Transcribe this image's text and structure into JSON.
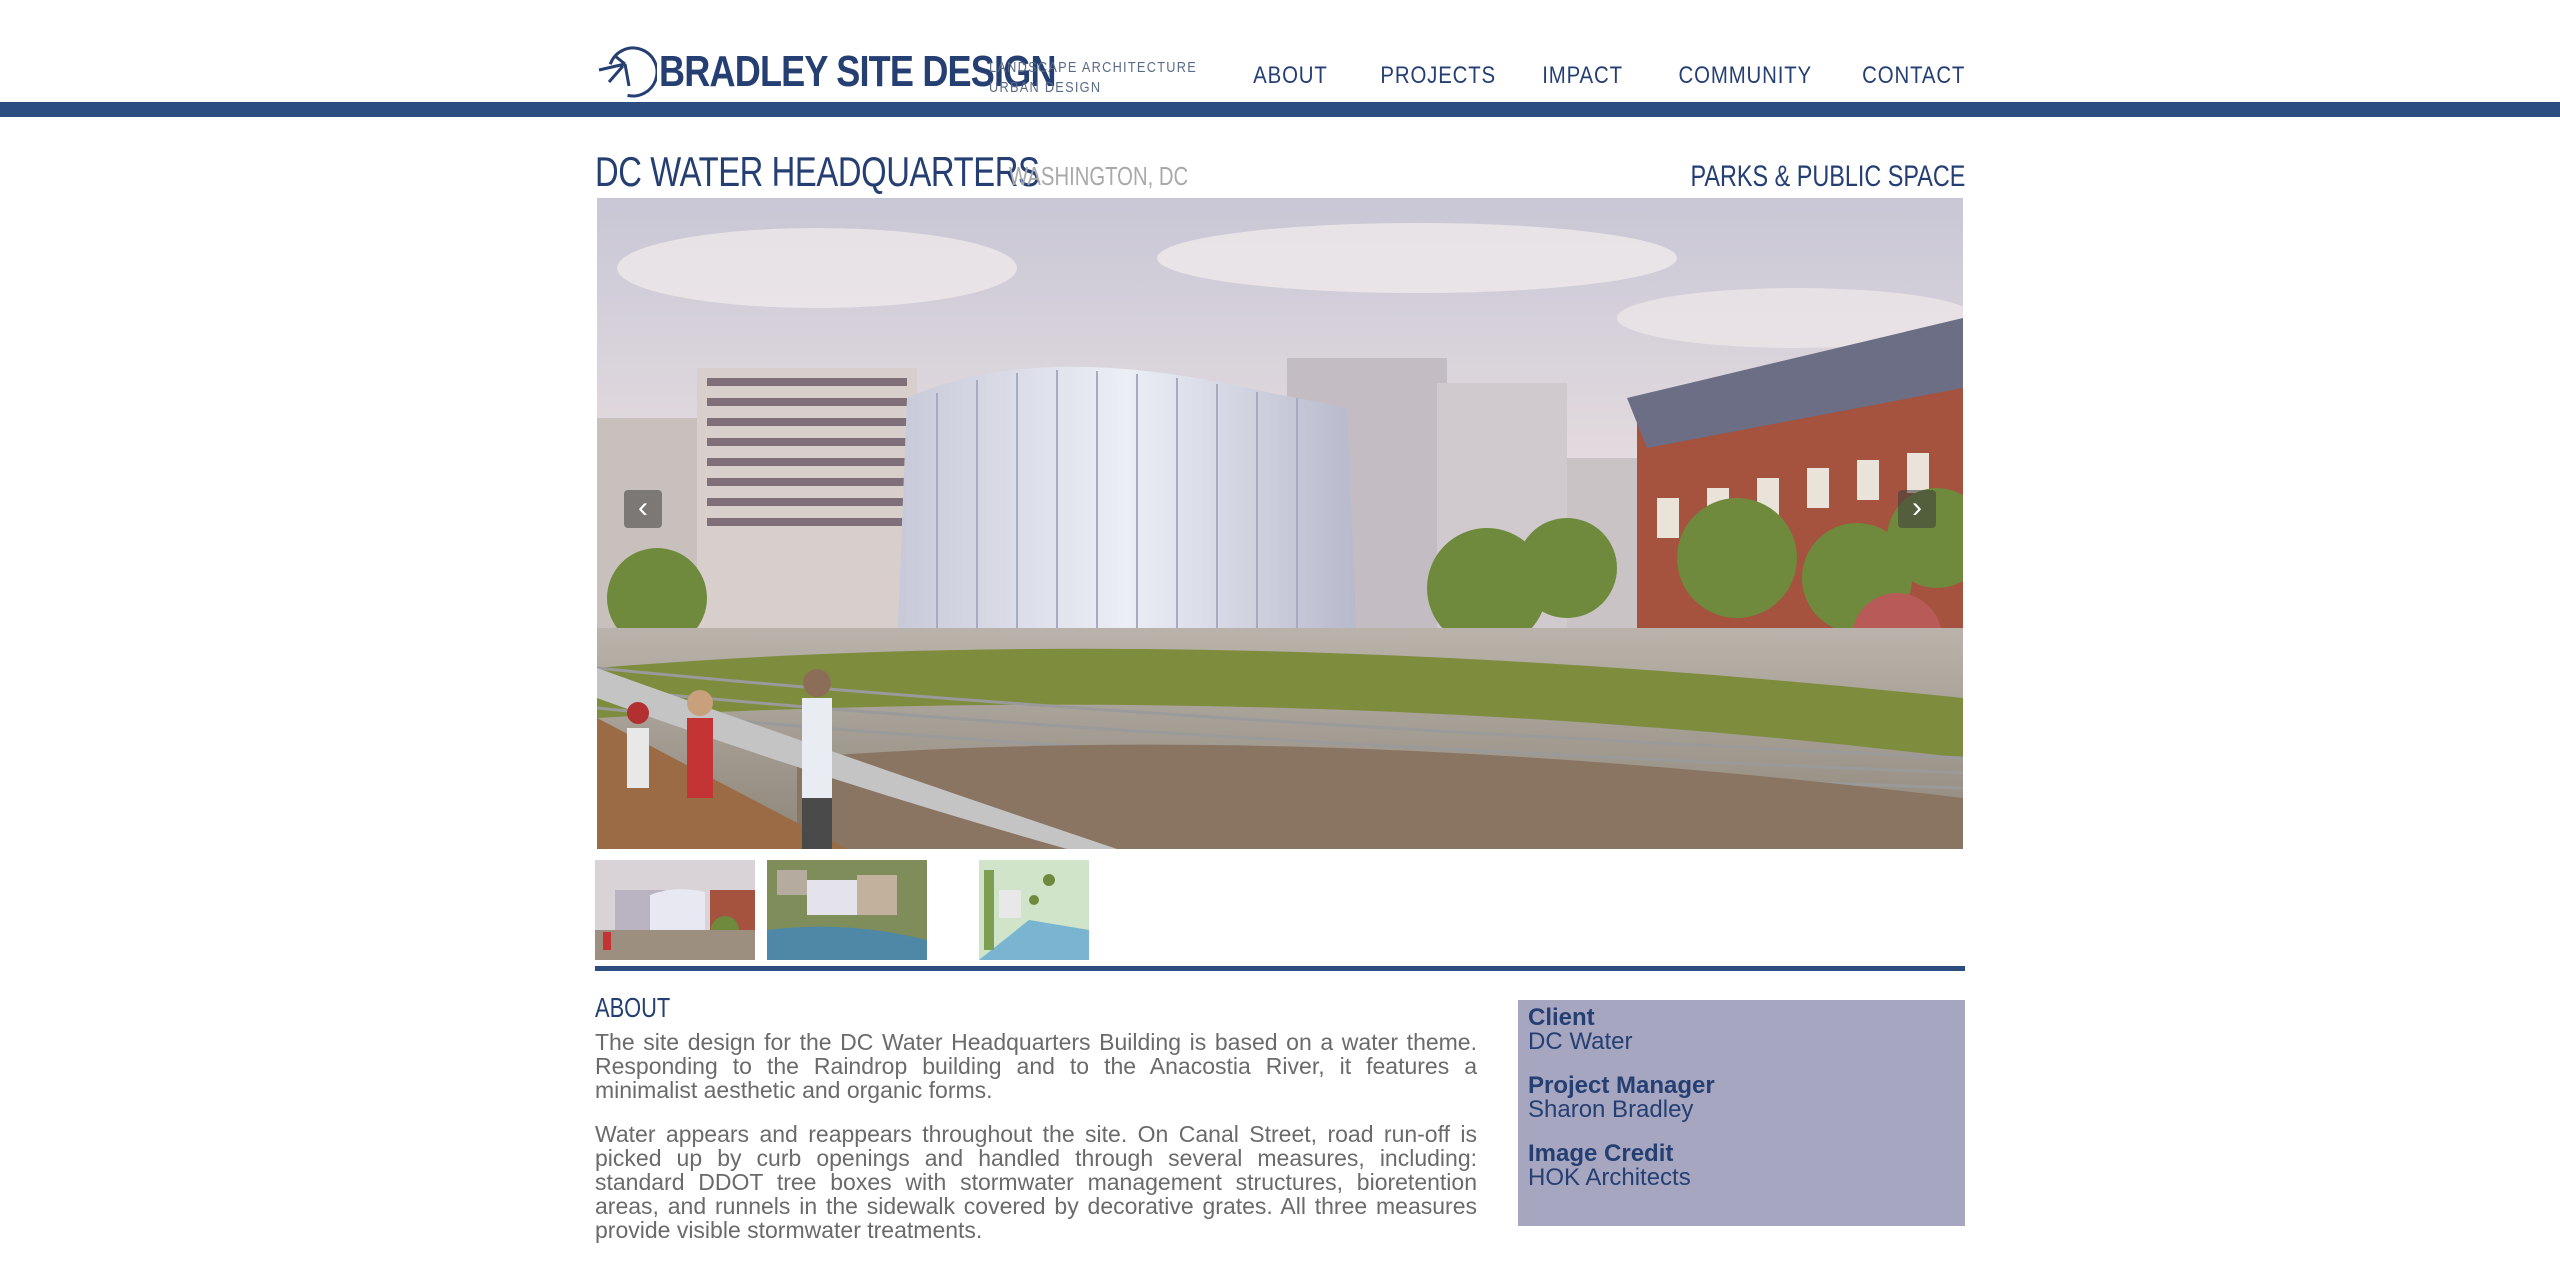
{
  "brand": {
    "name": "BRADLEY SITE DESIGN",
    "tagline_1": "LANDSCAPE ARCHITECTURE",
    "tagline_2": "URBAN DESIGN"
  },
  "nav": [
    "ABOUT",
    "PROJECTS",
    "IMPACT",
    "COMMUNITY",
    "CONTACT"
  ],
  "project": {
    "title": "DC WATER HEADQUARTERS",
    "location": "WASHINGTON, DC",
    "category": "PARKS & PUBLIC SPACE"
  },
  "slideshow": {
    "prev_icon": "chevron-left-icon",
    "next_icon": "chevron-right-icon",
    "thumbnail_count": 3
  },
  "about": {
    "heading": "ABOUT",
    "paragraphs": [
      "The site design for the DC Water Headquarters Building is based on a water theme. Responding to the Raindrop building and to the Anacostia River, it features a minimalist aesthetic and organic forms.",
      "Water appears and reappears throughout the site. On Canal Street, road run-off is picked up by curb openings and handled through several measures, including: standard DDOT tree boxes with stormwater management structures, bioretention areas, and runnels in the sidewalk covered by decorative grates. All three measures provide visible stormwater treatments."
    ]
  },
  "info": [
    {
      "label": "Client",
      "value": "DC Water"
    },
    {
      "label": "Project Manager",
      "value": "Sharon Bradley"
    },
    {
      "label": "Image Credit",
      "value": "HOK Architects"
    }
  ],
  "colors": {
    "brand_blue": "#2b4d80",
    "info_bg": "#a6a6c0",
    "text_gray": "#6a6a6a"
  }
}
